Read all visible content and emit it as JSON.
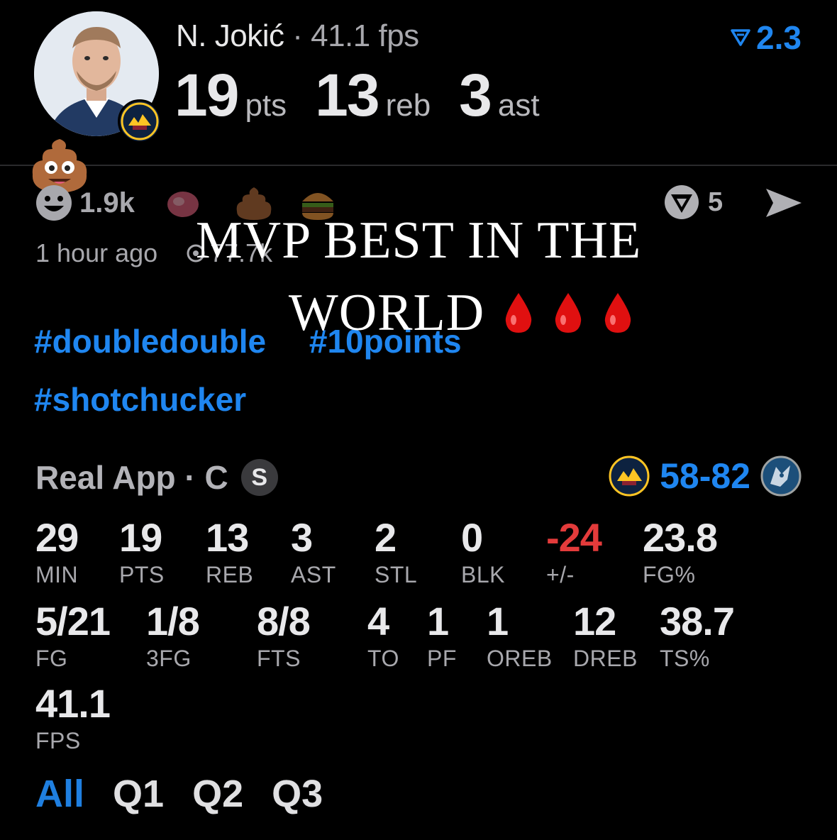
{
  "header": {
    "player_name": "N. Jokić",
    "separator": "·",
    "fps": "41.1 fps",
    "rank_value": "2.3",
    "stats": [
      {
        "value": "19",
        "unit": "pts"
      },
      {
        "value": "13",
        "unit": "reb"
      },
      {
        "value": "3",
        "unit": "ast"
      }
    ]
  },
  "reactions": {
    "count": "1.9k",
    "time_ago": "1 hour ago",
    "views": "77.7k",
    "reply_count": "5"
  },
  "caption": {
    "line1": "MVP BEST IN THE",
    "line2": "WORLD"
  },
  "tags": [
    "#doubledouble",
    "#10points",
    "#shotchucker"
  ],
  "box": {
    "app_label": "Real App · C",
    "badge": "S",
    "score": "58-82",
    "row1": [
      {
        "v": "29",
        "l": "MIN"
      },
      {
        "v": "19",
        "l": "PTS"
      },
      {
        "v": "13",
        "l": "REB"
      },
      {
        "v": "3",
        "l": "AST"
      },
      {
        "v": "2",
        "l": "STL"
      },
      {
        "v": "0",
        "l": "BLK"
      },
      {
        "v": "-24",
        "l": "+/-"
      },
      {
        "v": "23.8",
        "l": "FG%"
      }
    ],
    "row2": [
      {
        "v": "5/21",
        "l": "FG"
      },
      {
        "v": "1/8",
        "l": "3FG"
      },
      {
        "v": "8/8",
        "l": "FTS"
      },
      {
        "v": "4",
        "l": "TO"
      },
      {
        "v": "1",
        "l": "PF"
      },
      {
        "v": "1",
        "l": "OREB"
      },
      {
        "v": "12",
        "l": "DREB"
      },
      {
        "v": "38.7",
        "l": "TS%"
      }
    ],
    "row3": [
      {
        "v": "41.1",
        "l": "FPS"
      }
    ]
  },
  "tabs": [
    "All",
    "Q1",
    "Q2",
    "Q3"
  ],
  "colors": {
    "accent": "#1f86f0",
    "negative": "#e33b3b",
    "background": "#000000"
  }
}
